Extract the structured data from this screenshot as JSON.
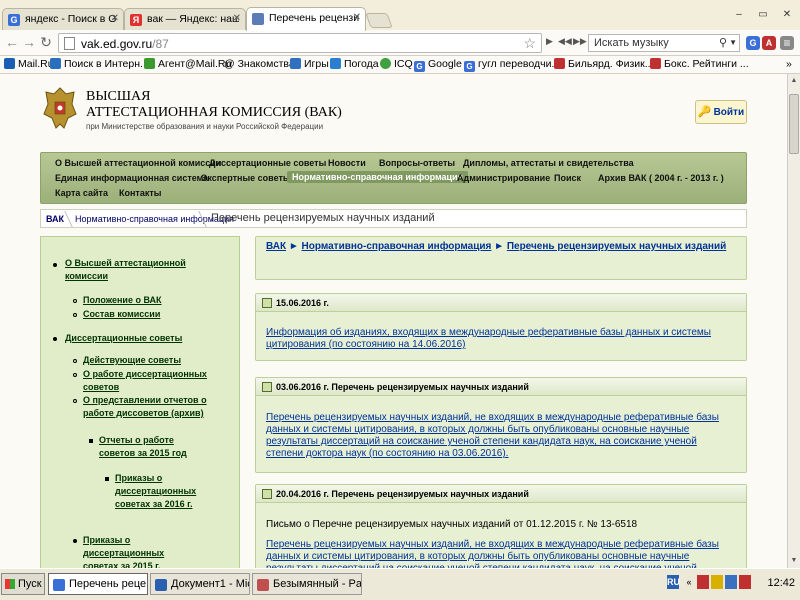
{
  "browser": {
    "tabs": [
      {
        "label": "яндекс - Поиск в Goo",
        "icon": "google-icon",
        "color": "#3b6fd8",
        "letter": "G"
      },
      {
        "label": "вак — Яндекс: нашло",
        "icon": "yandex-icon",
        "color": "#e03030",
        "letter": "Я"
      },
      {
        "label": "Перечень рецензиру",
        "icon": "page-icon",
        "color": "#5a7bb5",
        "letter": ""
      }
    ],
    "url_host": "vak.ed.gov.ru",
    "url_path": "/87",
    "music_search_placeholder": "Искать музыку",
    "window_buttons": [
      "–",
      "▭",
      "✕"
    ],
    "bookmarks": [
      {
        "label": "Mail.Ru",
        "color": "#1a5fb4"
      },
      {
        "label": "Поиск в Интерн...",
        "color": "#2a6fbf"
      },
      {
        "label": "Агент@Mail.Ru",
        "color": "#3a9a30"
      },
      {
        "label": "@ Знакомства",
        "color": "#1a5fb4"
      },
      {
        "label": "Игры",
        "color": "#3070c0"
      },
      {
        "label": "Погода",
        "color": "#2a7fd0"
      },
      {
        "label": "ICQ",
        "color": "#40a040"
      },
      {
        "label": "Google",
        "color": "#3b6fd8"
      },
      {
        "label": "гугл переводчи...",
        "color": "#3b6fd8"
      },
      {
        "label": "Бильярд. Физик...",
        "color": "#c03030"
      },
      {
        "label": "Бокс. Рейтинги ...",
        "color": "#c03030"
      }
    ],
    "bookmarks_more": "»"
  },
  "site": {
    "title_line1": "ВЫСШАЯ",
    "title_line2": "АТТЕСТАЦИОННАЯ КОМИССИЯ (ВАК)",
    "title_line3": "при Министерстве образования и науки Российской Федерации",
    "login_label": "Войти",
    "nav": [
      "О Высшей аттестационной комиссии",
      "Диссертационные советы",
      "Новости",
      "Вопросы-ответы",
      "Дипломы, аттестаты и свидетельства",
      "Единая информационная система",
      "Экспертные советы",
      "Нормативно-справочная информация",
      "Администрирование",
      "Поиск",
      "Архив ВАК ( 2004 г. - 2013 г. )",
      "Карта сайта",
      "Контакты"
    ],
    "breadcrumbs": [
      "ВАК",
      "Нормативно-справочная информация",
      "Перечень рецензируемых научных изданий"
    ],
    "left_menu": [
      "О Высшей аттестационной комиссии",
      "Положение о ВАК",
      "Состав комиссии",
      "Диссертационные советы",
      "Действующие советы",
      "О работе диссертационных советов",
      "О представлении отчетов о работе диссоветов (архив)",
      "Отчеты о работе советов за 2015 год",
      "Приказы о диссертационных советах за 2016 г.",
      "Приказы о диссертационных советах за 2015 г."
    ],
    "content_breadcrumb": {
      "a": "ВАК",
      "sep": "►",
      "b": "Нормативно-справочная информация",
      "c": "Перечень рецензируемых научных изданий"
    },
    "news": [
      {
        "header": "15.06.2016 г.",
        "link": "Информация об изданиях, входящих в международные реферативные базы данных и системы цитирования (по состоянию на 14.06.2016)"
      },
      {
        "header": "03.06.2016 г. Перечень рецензируемых научных изданий",
        "link": "Перечень рецензируемых научных изданий, не входящих в международные реферативные базы данных и системы цитирования, в которых должны быть опубликованы основные научные результаты диссертаций на соискание ученой степени кандидата наук, на соискание ученой степени доктора наук (по состоянию на 03.06.2016)."
      },
      {
        "header": "20.04.2016 г. Перечень рецензируемых научных изданий",
        "text": "Письмо о Перечне рецензируемых научных изданий от 01.12.2015 г. № 13-6518",
        "link": "Перечень рецензируемых научных изданий, не входящих в международные реферативные базы данных и системы цитирования, в которых должны быть опубликованы основные научные результаты диссертаций на соискание ученой степени кандидата наук, на соискание ученой степени доктора"
      }
    ]
  },
  "taskbar": {
    "start": "Пуск",
    "tasks": [
      {
        "label": "Перечень реце...",
        "color": "#3b6fd8"
      },
      {
        "label": "Документ1 - Micr...",
        "color": "#2b5fb0"
      },
      {
        "label": "Безымянный - Paint",
        "color": "#c05050"
      }
    ],
    "lang": "RU",
    "clock": "12:42"
  }
}
